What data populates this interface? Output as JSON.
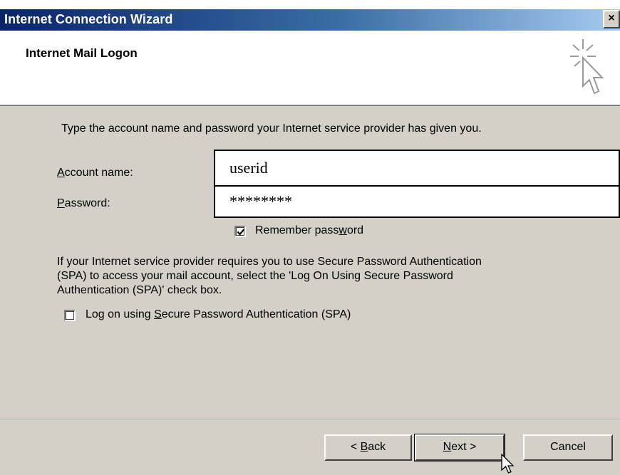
{
  "window": {
    "title": "Internet Connection Wizard",
    "close_label": "×"
  },
  "header": {
    "title": "Internet Mail Logon",
    "icon": "wizard-cursor-icon"
  },
  "instruction": "Type the account name and password your Internet service provider has given you.",
  "account": {
    "label_ul": "A",
    "label_rest": "ccount name:",
    "value": "userid"
  },
  "password": {
    "label_ul": "P",
    "label_rest": "assword:",
    "value": "********"
  },
  "remember": {
    "label_pre": "Remember pass",
    "label_ul": "w",
    "label_post": "ord",
    "checked": true
  },
  "spa_info": {
    "line1": "If your Internet service provider requires you to use Secure Password Authentication",
    "line2": "(SPA) to access your mail account, select the 'Log On Using Secure Password",
    "line3": "Authentication (SPA)' check box."
  },
  "spa_checkbox": {
    "label_pre": "Log on using ",
    "label_ul": "S",
    "label_post": "ecure Password Authentication (SPA)",
    "checked": false
  },
  "buttons": {
    "back_pre": "< ",
    "back_ul": "B",
    "back_post": "ack",
    "next_ul": "N",
    "next_post": "ext >",
    "cancel": "Cancel"
  }
}
